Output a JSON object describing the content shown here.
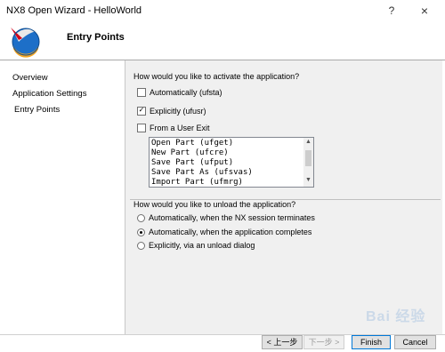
{
  "window": {
    "title": "NX8 Open Wizard - HelloWorld",
    "help_glyph": "?",
    "close_glyph": "×"
  },
  "header": {
    "title": "Entry Points",
    "logo_icon": "nx-logo-icon"
  },
  "sidebar": {
    "items": [
      {
        "label": "Overview"
      },
      {
        "label": "Application Settings"
      },
      {
        "label": "Entry Points"
      }
    ]
  },
  "activate": {
    "question": "How would you like to activate the application?",
    "options": [
      {
        "label": "Automatically (ufsta)",
        "checked": false
      },
      {
        "label": "Explicitly (ufusr)",
        "checked": true
      },
      {
        "label": "From a User Exit",
        "checked": false
      }
    ],
    "user_exit_list": [
      "Open Part (ufget)",
      "New Part (ufcre)",
      "Save Part (ufput)",
      "Save Part As (ufsvas)",
      "Import Part (ufmrg)"
    ]
  },
  "unload": {
    "question": "How would you like to unload the application?",
    "options": [
      {
        "label": "Automatically, when the  NX session terminates",
        "selected": false
      },
      {
        "label": "Automatically, when the application completes",
        "selected": true
      },
      {
        "label": "Explicitly, via an unload dialog",
        "selected": false
      }
    ]
  },
  "buttons": {
    "back": "< 上一步",
    "next": "下一步 >",
    "finish": "Finish",
    "cancel": "Cancel"
  },
  "watermark": {
    "text": "Bai 经验"
  },
  "colors": {
    "accent": "#0078d7",
    "panel_bg": "#f0f0f0"
  }
}
